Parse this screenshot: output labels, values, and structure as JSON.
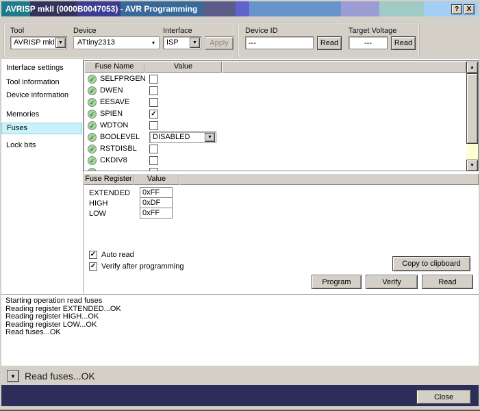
{
  "window": {
    "title": "AVRISP mkII (0000B0047053) - AVR Programming",
    "help_button": "?",
    "close_button": "X"
  },
  "toolbar": {
    "tool_label": "Tool",
    "tool_value": "AVRISP mkII",
    "device_label": "Device",
    "device_value": "ATtiny2313",
    "interface_label": "Interface",
    "interface_value": "ISP",
    "apply_label": "Apply",
    "device_id_label": "Device ID",
    "device_id_value": "---",
    "device_id_read_label": "Read",
    "target_voltage_label": "Target Voltage",
    "target_voltage_value": "---",
    "target_voltage_read_label": "Read"
  },
  "sidebar": {
    "items": [
      {
        "label": "Interface settings",
        "selected": false
      },
      {
        "label": "Tool information",
        "selected": false
      },
      {
        "label": "Device information",
        "selected": false
      },
      {
        "label": "Memories",
        "selected": false
      },
      {
        "label": "Fuses",
        "selected": true
      },
      {
        "label": "Lock bits",
        "selected": false
      }
    ]
  },
  "fuse_table": {
    "headers": [
      "Fuse Name",
      "Value"
    ],
    "rows": [
      {
        "name": "SELFPRGEN",
        "checked": false,
        "check_glyph": ""
      },
      {
        "name": "DWEN",
        "checked": false,
        "check_glyph": ""
      },
      {
        "name": "EESAVE",
        "checked": false,
        "check_glyph": ""
      },
      {
        "name": "SPIEN",
        "checked": true,
        "check_glyph": "✓"
      },
      {
        "name": "WDTON",
        "checked": false,
        "check_glyph": ""
      },
      {
        "name": "BODLEVEL",
        "type": "select",
        "value": "DISABLED"
      },
      {
        "name": "RSTDISBL",
        "checked": false,
        "check_glyph": ""
      },
      {
        "name": "CKDIV8",
        "checked": false,
        "check_glyph": ""
      }
    ]
  },
  "register_table": {
    "headers": [
      "Fuse Register",
      "Value"
    ],
    "rows": [
      {
        "name": "EXTENDED",
        "value": "0xFF"
      },
      {
        "name": "HIGH",
        "value": "0xDF"
      },
      {
        "name": "LOW",
        "value": "0xFF"
      }
    ]
  },
  "options": {
    "auto_read_label": "Auto read",
    "auto_read_glyph": "✓",
    "verify_label": "Verify after programming",
    "verify_glyph": "✓"
  },
  "actions": {
    "copy_label": "Copy to clipboard",
    "program_label": "Program",
    "verify_label": "Verify",
    "read_label": "Read"
  },
  "log": {
    "lines": [
      "Starting operation read fuses",
      "Reading register EXTENDED...OK",
      "Reading register HIGH...OK",
      "Reading register LOW...OK",
      "Read fuses...OK"
    ]
  },
  "statusbar": {
    "message": "Read fuses...OK",
    "close_label": "Close"
  },
  "icons": {
    "ok_check": "✓",
    "combo_arrow": "▼",
    "flat_arrow": "▾",
    "up_arrow": "▲",
    "down_arrow": "▼",
    "drop_arrow": "▼"
  },
  "colors": {
    "classic_gray": "#d4d0c8",
    "navy_bar": "#2d2d5a",
    "nav_selected": "#c7f2f9",
    "fuse_ok_green": "#a5d69e",
    "scrollbar_track": "#ffffd6",
    "titlebar_segments": [
      "#1f7a8c",
      "#32325a",
      "#3c3c92",
      "#38699b",
      "#5c5c8a",
      "#6262ce",
      "#6795cb",
      "#9c9cd4",
      "#9fcbc4",
      "#a3cff7"
    ]
  }
}
